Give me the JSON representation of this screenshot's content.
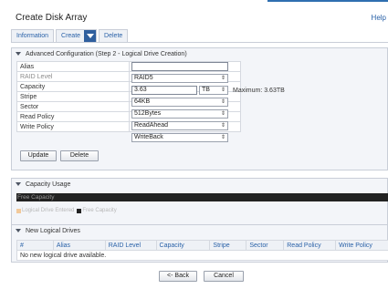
{
  "page": {
    "title": "Create Disk Array",
    "help_label": "Help"
  },
  "tabs": {
    "information": "Information",
    "create": "Create",
    "delete": "Delete"
  },
  "config": {
    "heading": "Advanced Configuration (Step 2 - Logical Drive Creation)",
    "rows": {
      "alias": {
        "label": "Alias",
        "value": ""
      },
      "raid_level": {
        "label": "RAID Level",
        "value": "RAID5"
      },
      "capacity": {
        "label": "Capacity",
        "value": "3.63",
        "unit": "TB",
        "max": "Maximum: 3.63TB"
      },
      "stripe": {
        "label": "Stripe",
        "value": "64KB"
      },
      "sector": {
        "label": "Sector",
        "value": "512Bytes"
      },
      "read_policy": {
        "label": "Read Policy",
        "value": "ReadAhead"
      },
      "write_policy": {
        "label": "Write Policy",
        "value": "WriteBack"
      }
    },
    "update_label": "Update",
    "delete_label": "Delete"
  },
  "capacity_usage": {
    "heading": "Capacity Usage",
    "bar_label": "Free Capacity",
    "legend_entered": "Logical Drive Entered",
    "legend_free": "Free Capacity"
  },
  "new_drives": {
    "heading": "New Logical Drives",
    "columns": [
      "#",
      "Alias",
      "RAID Level",
      "Capacity",
      "Stripe",
      "Sector",
      "Read Policy",
      "Write Policy"
    ],
    "empty_message": "No new logical drive available."
  },
  "footer": {
    "back_label": "<- Back",
    "cancel_label": "Cancel"
  },
  "colors": {
    "accent": "#2f6fb0",
    "link": "#2a62a8",
    "dropdown": "#2f5f9e",
    "bar": "#222222",
    "entered": "#f2c99a"
  }
}
